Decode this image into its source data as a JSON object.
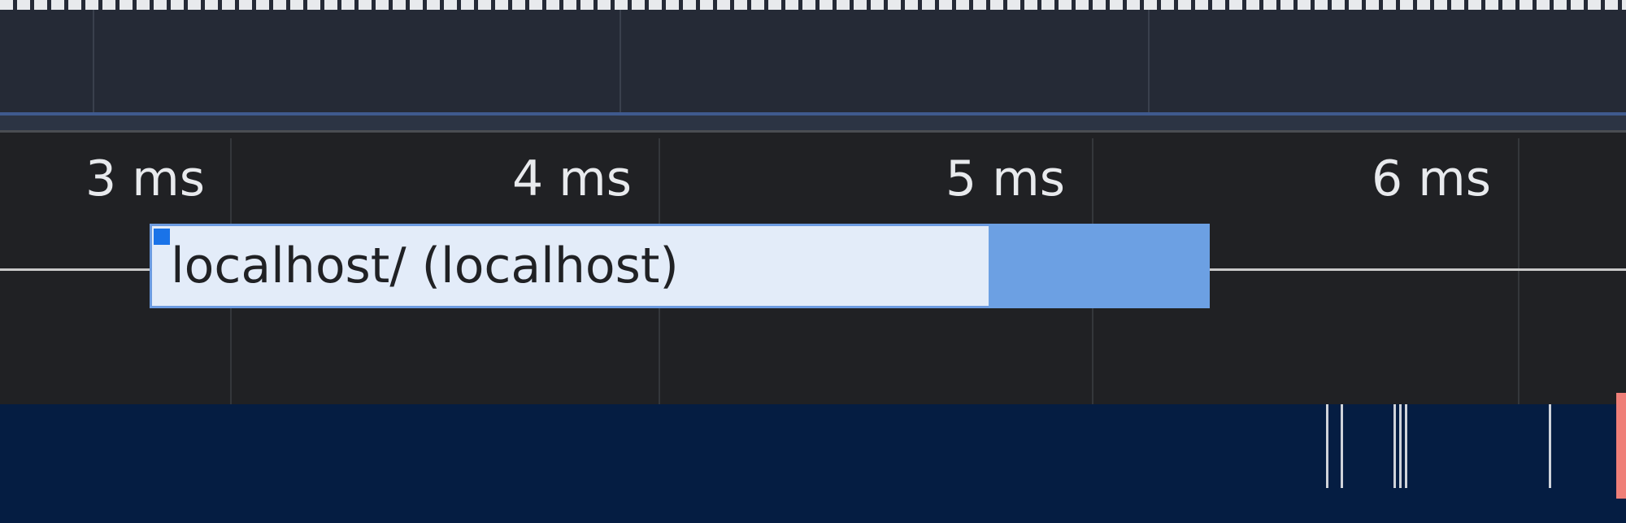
{
  "ruler": {
    "ticks": [
      "3 ms",
      "4 ms",
      "5 ms",
      "6 ms"
    ]
  },
  "network": {
    "request_label": "localhost/ (localhost)"
  },
  "colors": {
    "background": "#202124",
    "overview_background": "#252a36",
    "request_bar_fill": "#e3ecf9",
    "request_bar_receive": "#6ca0e3",
    "request_marker": "#1a73e8",
    "frames_track": "#051d42",
    "end_marker": "#ef7f78"
  }
}
